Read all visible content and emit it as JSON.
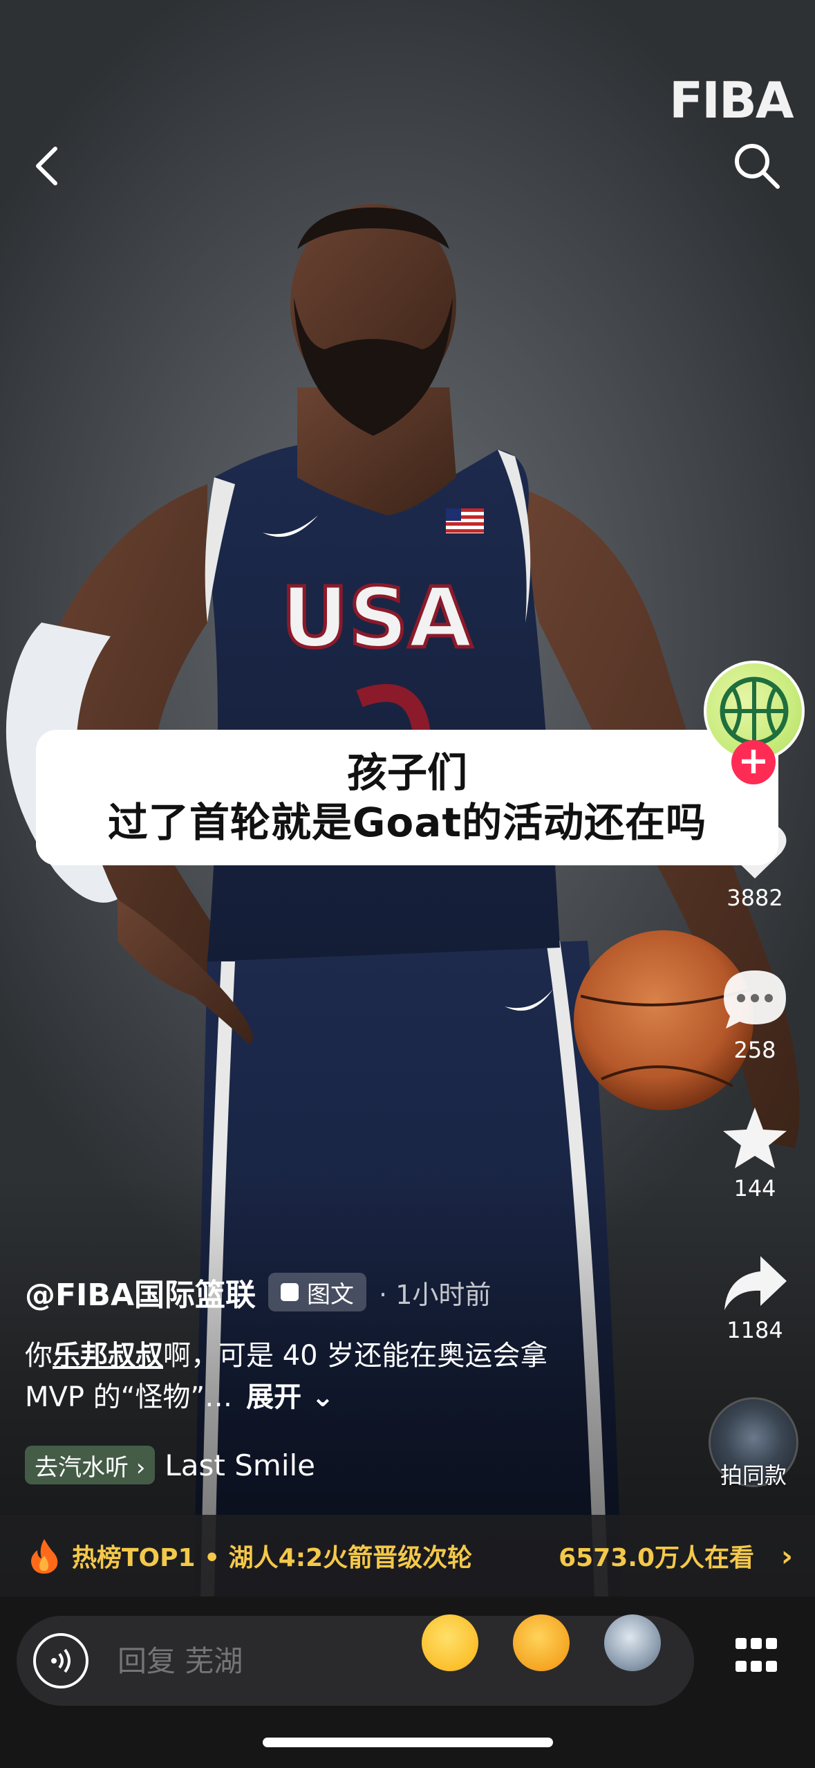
{
  "header": {
    "logo_text": "FIBA",
    "back_icon": "chevron-left-icon",
    "search_icon": "search-icon"
  },
  "caption": {
    "line1": "孩子们",
    "line2": "过了首轮就是Goat的活动还在吗"
  },
  "jersey": {
    "text": "USA"
  },
  "actions": {
    "like_count": "3882",
    "comment_count": "258",
    "favorite_count": "144",
    "share_count": "1184",
    "same_style_label": "拍同款"
  },
  "post": {
    "author": "@FIBA国际篮联",
    "type_tag": "图文",
    "time": "· 1小时前",
    "desc_prefix": "你",
    "desc_mention": "乐邦叔叔",
    "desc_rest": "啊，可是 40 岁还能在奥运会拿",
    "desc_line2": "MVP 的“怪物”…",
    "expand_label": "展开",
    "music_tag": "去汽水听 ›",
    "music_name": "Last Smile"
  },
  "hot": {
    "text": "热榜TOP1 • 湖人4:2火箭晋级次轮",
    "viewers": "6573.0万人在看",
    "arrow": "›"
  },
  "bottom": {
    "reply_placeholder": "回复 芜湖"
  },
  "colors": {
    "accent_red": "#fe2c55",
    "hot_yellow": "#f4c84a"
  }
}
